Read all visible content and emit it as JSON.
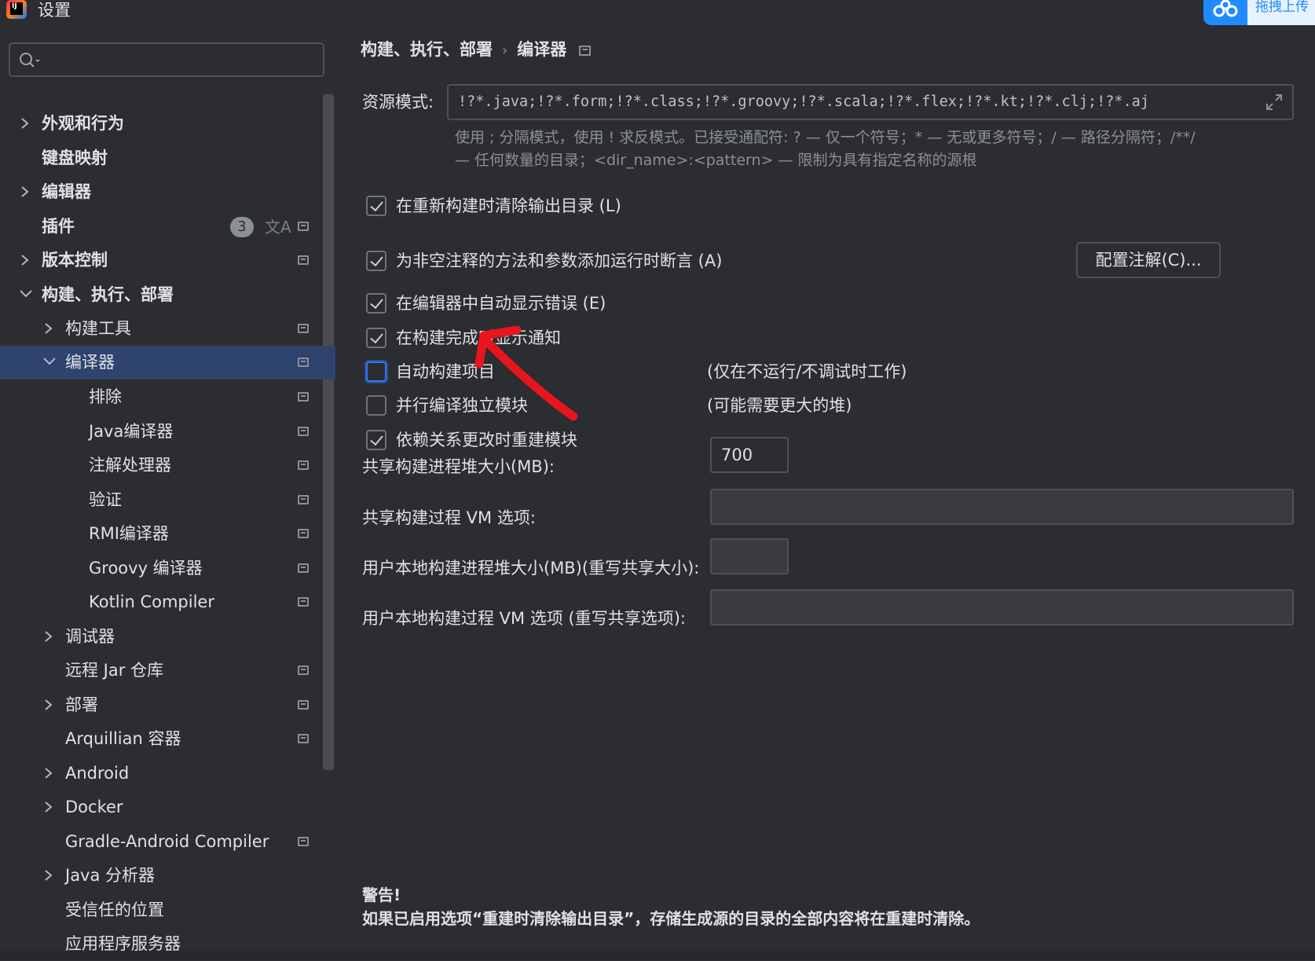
{
  "window": {
    "title": "设置"
  },
  "baidu": {
    "text": "拖拽上传"
  },
  "search": {
    "placeholder": ""
  },
  "sidebar": {
    "items": [
      {
        "label": "外观和行为"
      },
      {
        "label": "键盘映射"
      },
      {
        "label": "编辑器"
      },
      {
        "label": "插件",
        "badge": "3"
      },
      {
        "label": "版本控制"
      },
      {
        "label": "构建、执行、部署"
      },
      {
        "label": "构建工具"
      },
      {
        "label": "编译器"
      },
      {
        "label": "排除"
      },
      {
        "label": "Java编译器"
      },
      {
        "label": "注解处理器"
      },
      {
        "label": "验证"
      },
      {
        "label": "RMI编译器"
      },
      {
        "label": "Groovy 编译器"
      },
      {
        "label": "Kotlin Compiler"
      },
      {
        "label": "调试器"
      },
      {
        "label": "远程 Jar 仓库"
      },
      {
        "label": "部署"
      },
      {
        "label": "Arquillian 容器"
      },
      {
        "label": "Android"
      },
      {
        "label": "Docker"
      },
      {
        "label": "Gradle-Android Compiler"
      },
      {
        "label": "Java 分析器"
      },
      {
        "label": "受信任的位置"
      },
      {
        "label": "应用程序服务器"
      }
    ]
  },
  "breadcrumb": {
    "parent": "构建、执行、部署",
    "separator": "›",
    "current": "编译器"
  },
  "resource": {
    "label": "资源模式:",
    "value": "!?*.java;!?*.form;!?*.class;!?*.groovy;!?*.scala;!?*.flex;!?*.kt;!?*.clj;!?*.aj",
    "hint_line1": "使用 ; 分隔模式，使用 ! 求反模式。已接受通配符: ? — 仅一个符号；* — 无或更多符号；/ — 路径分隔符；/**/",
    "hint_line2": "— 任何数量的目录；<dir_name>:<pattern> — 限制为具有指定名称的源根"
  },
  "checkboxes": [
    {
      "label": "在重新构建时清除输出目录 (L)",
      "checked": true
    },
    {
      "label": "为非空注释的方法和参数添加运行时断言 (A)",
      "checked": true
    },
    {
      "label": "在编辑器中自动显示错误 (E)",
      "checked": true
    },
    {
      "label": "在构建完成时显示通知",
      "checked": true
    },
    {
      "label": "自动构建项目",
      "checked": false,
      "note": "(仅在不运行/不调试时工作)"
    },
    {
      "label": "并行编译独立模块",
      "checked": false,
      "note": "(可能需要更大的堆)"
    },
    {
      "label": "依赖关系更改时重建模块",
      "checked": true
    }
  ],
  "config_button": {
    "label": "配置注解(C)..."
  },
  "form": {
    "heap_label": "共享构建进程堆大小(MB):",
    "heap_value": "700",
    "vm_label": "共享构建过程 VM 选项:",
    "vm_value": "",
    "user_heap_label": "用户本地构建进程堆大小(MB)(重写共享大小):",
    "user_heap_value": "",
    "user_vm_label": "用户本地构建过程 VM 选项 (重写共享选项):",
    "user_vm_value": ""
  },
  "warning": {
    "title": "警告!",
    "text": "如果已启用选项“重建时清除输出目录”，存储生成源的目录的全部内容将在重建时清除。"
  },
  "colors": {
    "background": "#2b2d30",
    "selection": "#2e436e",
    "accent": "#3574f0",
    "annotation_arrow": "#e8141e"
  }
}
